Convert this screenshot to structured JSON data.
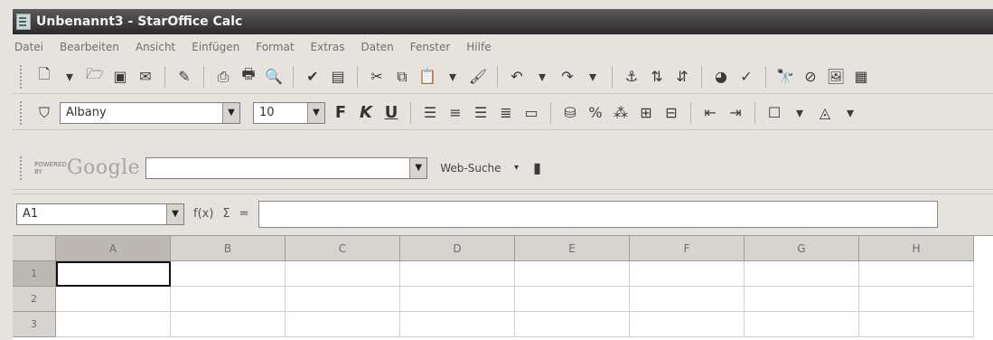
{
  "window": {
    "title": "Unbenannt3 - StarOffice Calc"
  },
  "menu": [
    "Datei",
    "Bearbeiten",
    "Ansicht",
    "Einfügen",
    "Format",
    "Extras",
    "Daten",
    "Fenster",
    "Hilfe"
  ],
  "format_toolbar": {
    "font_name": "Albany",
    "font_size": "10",
    "bold_label": "F",
    "italic_label": "K",
    "underline_label": "U"
  },
  "google_toolbar": {
    "powered_label": "POWERED BY",
    "logo_text": "Google",
    "search_value": "",
    "web_search_label": "Web-Suche"
  },
  "formula_bar": {
    "name_box": "A1",
    "function_label": "f(x)",
    "sum_label": "Σ",
    "equals_label": "=",
    "formula_value": ""
  },
  "sheet": {
    "columns": [
      "A",
      "B",
      "C",
      "D",
      "E",
      "F",
      "G",
      "H"
    ],
    "rows": [
      "1",
      "2",
      "3"
    ],
    "selected_cell": "A1"
  }
}
